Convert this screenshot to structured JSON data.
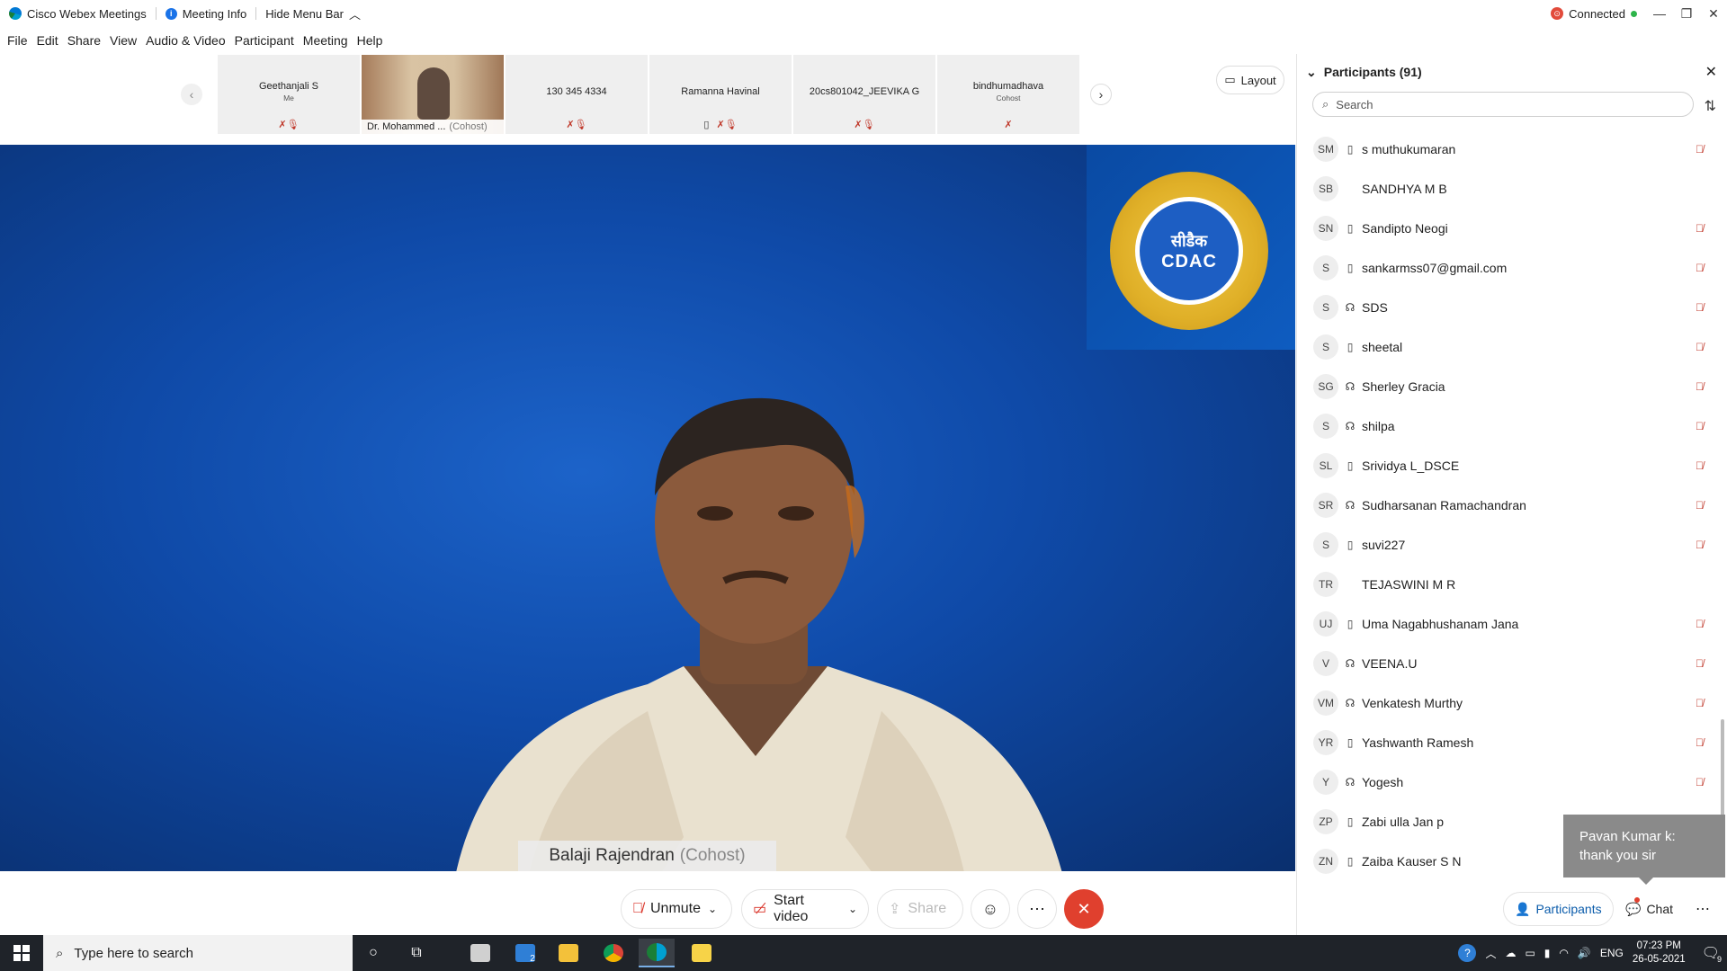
{
  "titlebar": {
    "app_name": "Cisco Webex Meetings",
    "meeting_info": "Meeting Info",
    "hide_menu": "Hide Menu Bar",
    "status": "Connected"
  },
  "menu": [
    "File",
    "Edit",
    "Share",
    "View",
    "Audio & Video",
    "Participant",
    "Meeting",
    "Help"
  ],
  "thumbnails": [
    {
      "name": "Geethanjali S",
      "role": "Me",
      "icons": "🎤̸"
    },
    {
      "name": "Dr. Mohammed ...",
      "role": "(Cohost)",
      "video": true
    },
    {
      "name": "130 345 4334",
      "role": "",
      "icons": "🎤̸"
    },
    {
      "name": "Ramanna Havinal",
      "role": "",
      "icons": "▯ 🎤̸"
    },
    {
      "name": "20cs801042_JEEVIKA G",
      "role": "",
      "icons": "🎤̸"
    },
    {
      "name": "bindhumadhava",
      "role": "Cohost",
      "icons": "🎤̸"
    }
  ],
  "layout_label": "Layout",
  "main_video": {
    "speaker_name": "Balaji Rajendran",
    "speaker_role": "(Cohost)",
    "logo_text_1": "सीडैक",
    "logo_text_2": "CDAC"
  },
  "controls": {
    "unmute": "Unmute",
    "start_video": "Start video",
    "share": "Share"
  },
  "participants_panel": {
    "title": "Participants (91)",
    "search_placeholder": "Search",
    "list": [
      {
        "initials": "SM",
        "device": "▯",
        "name": "s muthukumaran",
        "muted": true
      },
      {
        "initials": "SB",
        "device": "",
        "name": "SANDHYA M B",
        "muted": false
      },
      {
        "initials": "SN",
        "device": "▯",
        "name": "Sandipto Neogi",
        "muted": true
      },
      {
        "initials": "S",
        "device": "▯",
        "name": "sankarmss07@gmail.com",
        "muted": true
      },
      {
        "initials": "S",
        "device": "☊",
        "name": "SDS",
        "muted": true
      },
      {
        "initials": "S",
        "device": "▯",
        "name": "sheetal",
        "muted": true
      },
      {
        "initials": "SG",
        "device": "☊",
        "name": "Sherley Gracia",
        "muted": true
      },
      {
        "initials": "S",
        "device": "☊",
        "name": "shilpa",
        "muted": true
      },
      {
        "initials": "SL",
        "device": "▯",
        "name": "Srividya L_DSCE",
        "muted": true
      },
      {
        "initials": "SR",
        "device": "☊",
        "name": "Sudharsanan Ramachandran",
        "muted": true
      },
      {
        "initials": "S",
        "device": "▯",
        "name": "suvi227",
        "muted": true
      },
      {
        "initials": "TR",
        "device": "",
        "name": "TEJASWINI M R",
        "muted": false
      },
      {
        "initials": "UJ",
        "device": "▯",
        "name": "Uma Nagabhushanam Jana",
        "muted": true
      },
      {
        "initials": "V",
        "device": "☊",
        "name": "VEENA.U",
        "muted": true
      },
      {
        "initials": "VM",
        "device": "☊",
        "name": "Venkatesh Murthy",
        "muted": true
      },
      {
        "initials": "YR",
        "device": "▯",
        "name": "Yashwanth Ramesh",
        "muted": true
      },
      {
        "initials": "Y",
        "device": "☊",
        "name": "Yogesh",
        "muted": true
      },
      {
        "initials": "ZP",
        "device": "▯",
        "name": "Zabi ulla Jan p",
        "muted": true
      },
      {
        "initials": "ZN",
        "device": "▯",
        "name": "Zaiba Kauser S N",
        "muted": true
      }
    ]
  },
  "toast": {
    "line1": "Pavan Kumar k:",
    "line2": "thank you sir"
  },
  "panel_tabs": {
    "participants": "Participants",
    "chat": "Chat"
  },
  "taskbar": {
    "search_placeholder": "Type here to search",
    "mail_badge": "2",
    "lang": "ENG",
    "time": "07:23 PM",
    "date": "26-05-2021",
    "notif_count": "9"
  },
  "colors": {
    "accent": "#0b5cab",
    "leave": "#e0402e",
    "muted": "#c0392b",
    "video_bg": "#0f4aa8"
  }
}
